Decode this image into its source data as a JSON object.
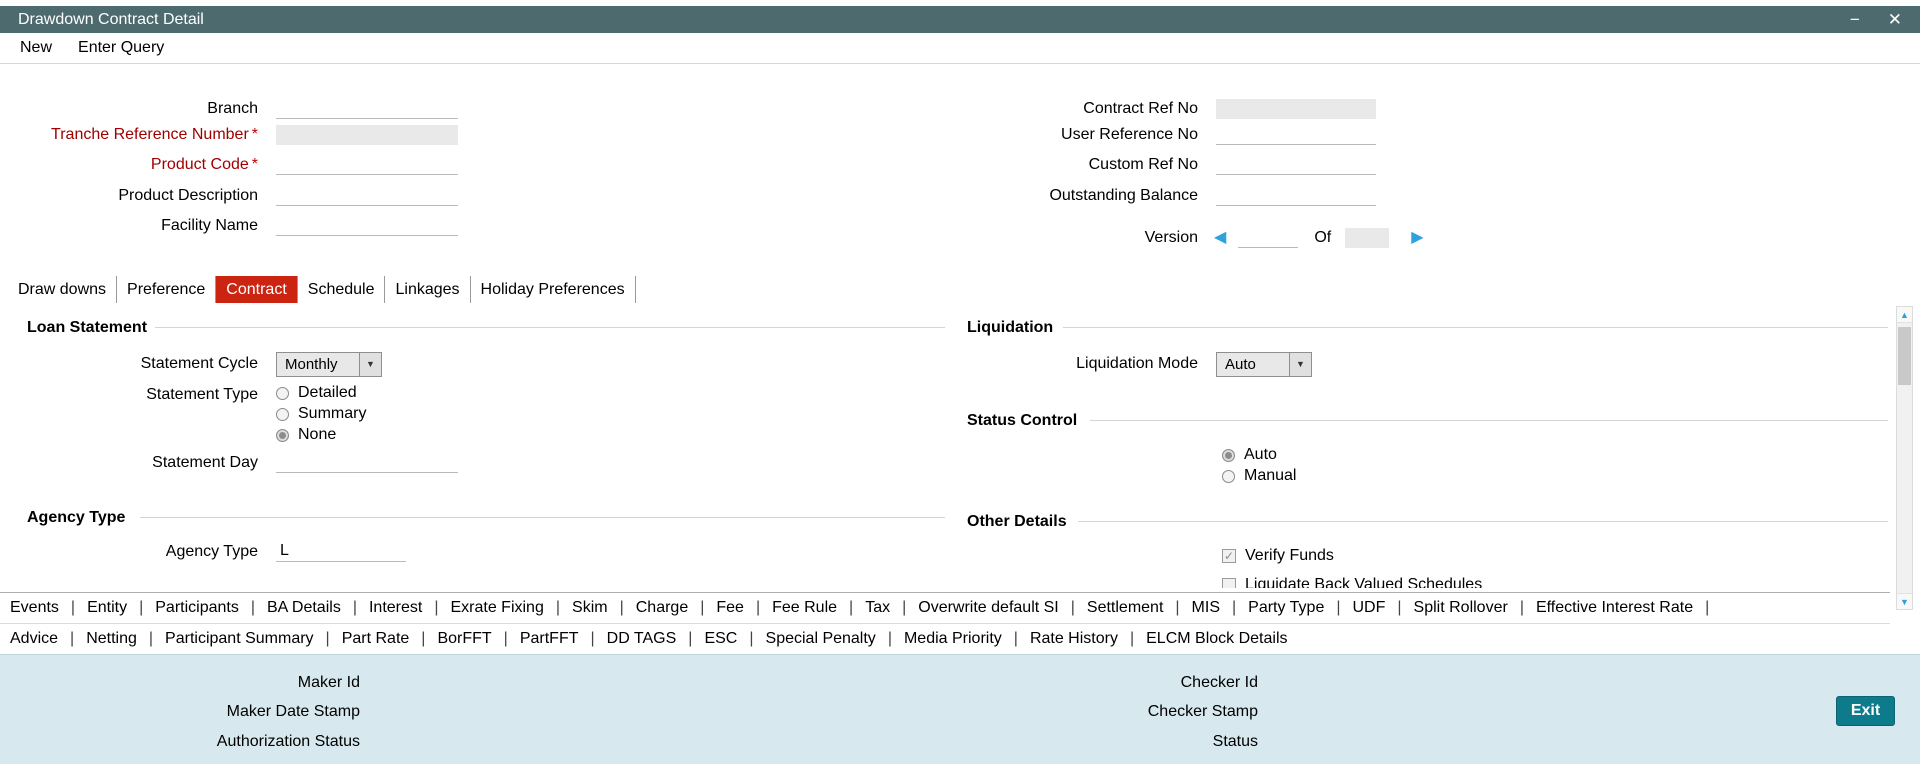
{
  "window": {
    "title": "Drawdown Contract Detail"
  },
  "icons": {
    "minimize": "−",
    "close": "✕",
    "dropdown": "▼",
    "scroll_up": "▲",
    "scroll_down": "▼",
    "check": "✓",
    "version_prev": "◀",
    "version_next": "▶"
  },
  "menu": {
    "new_label": "New",
    "enter_query_label": "Enter Query"
  },
  "form": {
    "required_marker": "*",
    "branch_label": "Branch",
    "tranche_ref_label": "Tranche Reference Number",
    "product_code_label": "Product Code",
    "product_desc_label": "Product Description",
    "facility_name_label": "Facility Name",
    "contract_ref_label": "Contract Ref No",
    "user_ref_label": "User Reference No",
    "custom_ref_label": "Custom Ref No",
    "outstanding_balance_label": "Outstanding Balance",
    "version": {
      "label": "Version",
      "of_label": "Of"
    }
  },
  "tabs": {
    "items": [
      "Draw downs",
      "Preference",
      "Contract",
      "Schedule",
      "Linkages",
      "Holiday Preferences"
    ],
    "active": "Contract"
  },
  "contract_tab": {
    "loan_statement": {
      "title": "Loan Statement",
      "statement_cycle_label": "Statement Cycle",
      "statement_cycle_value": "Monthly",
      "statement_type_label": "Statement Type",
      "statement_type_options": [
        "Detailed",
        "Summary",
        "None"
      ],
      "statement_type_selected": "None",
      "statement_day_label": "Statement Day"
    },
    "agency": {
      "title": "Agency Type",
      "agency_type_label": "Agency Type",
      "agency_type_value": "L"
    },
    "liquidation": {
      "title": "Liquidation",
      "mode_label": "Liquidation Mode",
      "mode_value": "Auto"
    },
    "status_control": {
      "title": "Status Control",
      "options": [
        "Auto",
        "Manual"
      ],
      "selected": "Auto"
    },
    "other_details": {
      "title": "Other Details",
      "checkboxes": [
        {
          "label": "Verify Funds",
          "checked": true
        },
        {
          "label": "Liquidate Back Valued Schedules",
          "checked": false
        }
      ]
    }
  },
  "links": {
    "row1": [
      "Events",
      "Entity",
      "Participants",
      "BA Details",
      "Interest",
      "Exrate Fixing",
      "Skim",
      "Charge",
      "Fee",
      "Fee Rule",
      "Tax",
      "Overwrite default SI",
      "Settlement",
      "MIS",
      "Party Type",
      "UDF",
      "Split Rollover",
      "Effective Interest Rate"
    ],
    "row2": [
      "Advice",
      "Netting",
      "Participant Summary",
      "Part Rate",
      "BorFFT",
      "PartFFT",
      "DD TAGS",
      "ESC",
      "Special Penalty",
      "Media Priority",
      "Rate History",
      "ELCM Block Details"
    ]
  },
  "footer": {
    "maker_id_label": "Maker Id",
    "maker_date_label": "Maker Date Stamp",
    "auth_status_label": "Authorization Status",
    "checker_id_label": "Checker Id",
    "checker_stamp_label": "Checker Stamp",
    "status_label": "Status",
    "exit_label": "Exit"
  }
}
